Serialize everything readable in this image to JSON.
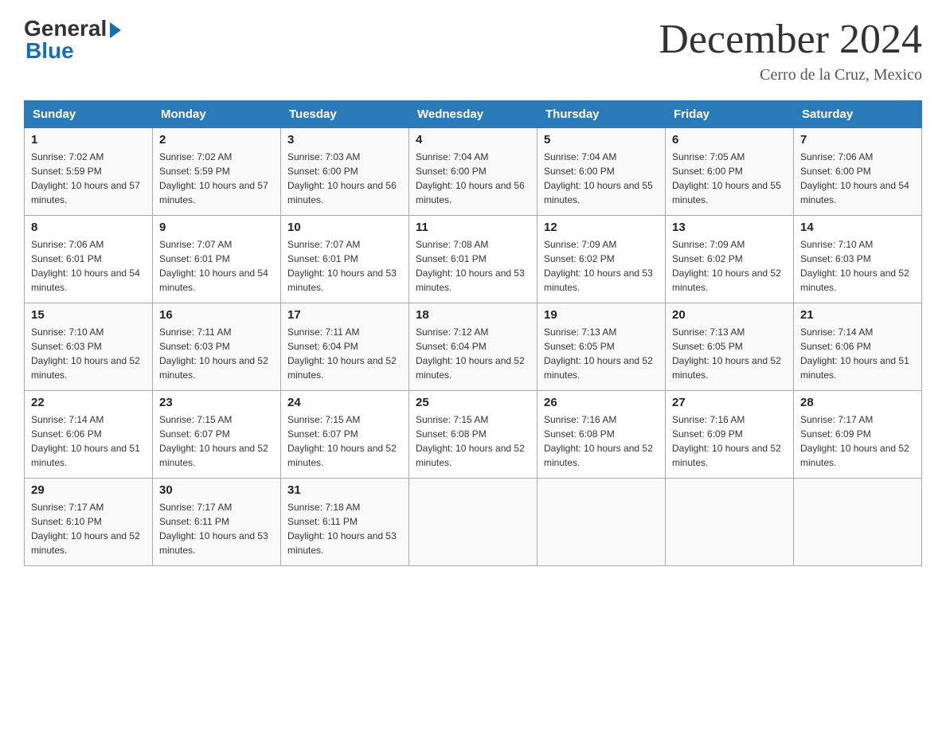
{
  "logo": {
    "general": "General",
    "blue": "Blue"
  },
  "title": "December 2024",
  "location": "Cerro de la Cruz, Mexico",
  "headers": [
    "Sunday",
    "Monday",
    "Tuesday",
    "Wednesday",
    "Thursday",
    "Friday",
    "Saturday"
  ],
  "weeks": [
    [
      {
        "day": "1",
        "sunrise": "7:02 AM",
        "sunset": "5:59 PM",
        "daylight": "10 hours and 57 minutes."
      },
      {
        "day": "2",
        "sunrise": "7:02 AM",
        "sunset": "5:59 PM",
        "daylight": "10 hours and 57 minutes."
      },
      {
        "day": "3",
        "sunrise": "7:03 AM",
        "sunset": "6:00 PM",
        "daylight": "10 hours and 56 minutes."
      },
      {
        "day": "4",
        "sunrise": "7:04 AM",
        "sunset": "6:00 PM",
        "daylight": "10 hours and 56 minutes."
      },
      {
        "day": "5",
        "sunrise": "7:04 AM",
        "sunset": "6:00 PM",
        "daylight": "10 hours and 55 minutes."
      },
      {
        "day": "6",
        "sunrise": "7:05 AM",
        "sunset": "6:00 PM",
        "daylight": "10 hours and 55 minutes."
      },
      {
        "day": "7",
        "sunrise": "7:06 AM",
        "sunset": "6:00 PM",
        "daylight": "10 hours and 54 minutes."
      }
    ],
    [
      {
        "day": "8",
        "sunrise": "7:06 AM",
        "sunset": "6:01 PM",
        "daylight": "10 hours and 54 minutes."
      },
      {
        "day": "9",
        "sunrise": "7:07 AM",
        "sunset": "6:01 PM",
        "daylight": "10 hours and 54 minutes."
      },
      {
        "day": "10",
        "sunrise": "7:07 AM",
        "sunset": "6:01 PM",
        "daylight": "10 hours and 53 minutes."
      },
      {
        "day": "11",
        "sunrise": "7:08 AM",
        "sunset": "6:01 PM",
        "daylight": "10 hours and 53 minutes."
      },
      {
        "day": "12",
        "sunrise": "7:09 AM",
        "sunset": "6:02 PM",
        "daylight": "10 hours and 53 minutes."
      },
      {
        "day": "13",
        "sunrise": "7:09 AM",
        "sunset": "6:02 PM",
        "daylight": "10 hours and 52 minutes."
      },
      {
        "day": "14",
        "sunrise": "7:10 AM",
        "sunset": "6:03 PM",
        "daylight": "10 hours and 52 minutes."
      }
    ],
    [
      {
        "day": "15",
        "sunrise": "7:10 AM",
        "sunset": "6:03 PM",
        "daylight": "10 hours and 52 minutes."
      },
      {
        "day": "16",
        "sunrise": "7:11 AM",
        "sunset": "6:03 PM",
        "daylight": "10 hours and 52 minutes."
      },
      {
        "day": "17",
        "sunrise": "7:11 AM",
        "sunset": "6:04 PM",
        "daylight": "10 hours and 52 minutes."
      },
      {
        "day": "18",
        "sunrise": "7:12 AM",
        "sunset": "6:04 PM",
        "daylight": "10 hours and 52 minutes."
      },
      {
        "day": "19",
        "sunrise": "7:13 AM",
        "sunset": "6:05 PM",
        "daylight": "10 hours and 52 minutes."
      },
      {
        "day": "20",
        "sunrise": "7:13 AM",
        "sunset": "6:05 PM",
        "daylight": "10 hours and 52 minutes."
      },
      {
        "day": "21",
        "sunrise": "7:14 AM",
        "sunset": "6:06 PM",
        "daylight": "10 hours and 51 minutes."
      }
    ],
    [
      {
        "day": "22",
        "sunrise": "7:14 AM",
        "sunset": "6:06 PM",
        "daylight": "10 hours and 51 minutes."
      },
      {
        "day": "23",
        "sunrise": "7:15 AM",
        "sunset": "6:07 PM",
        "daylight": "10 hours and 52 minutes."
      },
      {
        "day": "24",
        "sunrise": "7:15 AM",
        "sunset": "6:07 PM",
        "daylight": "10 hours and 52 minutes."
      },
      {
        "day": "25",
        "sunrise": "7:15 AM",
        "sunset": "6:08 PM",
        "daylight": "10 hours and 52 minutes."
      },
      {
        "day": "26",
        "sunrise": "7:16 AM",
        "sunset": "6:08 PM",
        "daylight": "10 hours and 52 minutes."
      },
      {
        "day": "27",
        "sunrise": "7:16 AM",
        "sunset": "6:09 PM",
        "daylight": "10 hours and 52 minutes."
      },
      {
        "day": "28",
        "sunrise": "7:17 AM",
        "sunset": "6:09 PM",
        "daylight": "10 hours and 52 minutes."
      }
    ],
    [
      {
        "day": "29",
        "sunrise": "7:17 AM",
        "sunset": "6:10 PM",
        "daylight": "10 hours and 52 minutes."
      },
      {
        "day": "30",
        "sunrise": "7:17 AM",
        "sunset": "6:11 PM",
        "daylight": "10 hours and 53 minutes."
      },
      {
        "day": "31",
        "sunrise": "7:18 AM",
        "sunset": "6:11 PM",
        "daylight": "10 hours and 53 minutes."
      },
      null,
      null,
      null,
      null
    ]
  ]
}
